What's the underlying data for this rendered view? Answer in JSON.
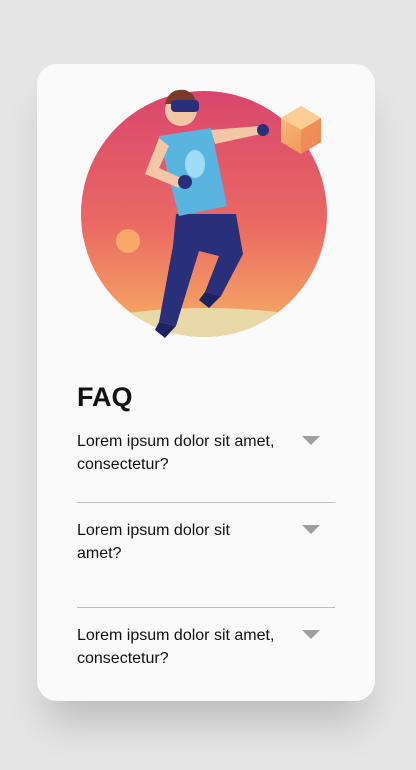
{
  "faq": {
    "title": "FAQ",
    "items": [
      {
        "question": "Lorem ipsum dolor sit amet, consectetur?"
      },
      {
        "question": "Lorem ipsum dolor sit amet?"
      },
      {
        "question": "Lorem ipsum dolor sit amet, consectetur?"
      }
    ]
  },
  "illustration": {
    "icon": "vr-player-illustration"
  },
  "colors": {
    "background": "#e5e5e5",
    "card": "#fafafa",
    "heading": "#111111",
    "caret": "#9e9e9e",
    "divider": "#bdbdbd",
    "gradient_top": "#d9466e",
    "gradient_bottom": "#f4a55f"
  }
}
